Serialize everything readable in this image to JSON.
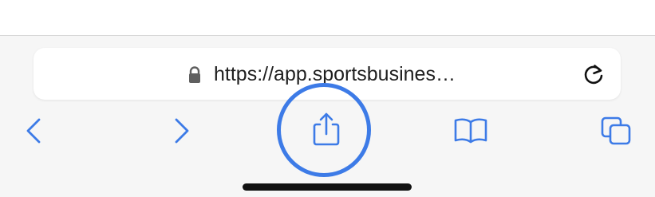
{
  "browser": {
    "address_bar": {
      "url": "https://app.sportsbusines…"
    },
    "icons": {
      "lock": "lock-icon",
      "reload": "reload-icon",
      "back": "back-chevron-icon",
      "forward": "forward-chevron-icon",
      "share": "share-icon",
      "bookmarks": "bookmarks-icon",
      "tabs": "tabs-icon"
    },
    "colors": {
      "accent": "#3d7be7",
      "toolbar": "#f6f6f6",
      "address_bar": "#ffffff",
      "text": "#1f1f1f"
    }
  }
}
